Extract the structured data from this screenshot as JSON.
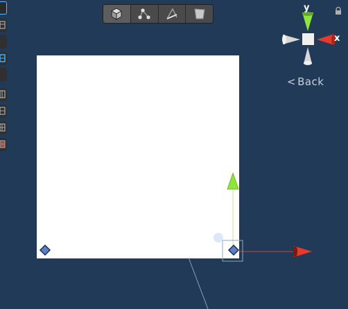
{
  "mode_toolbar": {
    "buttons": [
      {
        "icon": "object-mode-cube-icon",
        "active": true
      },
      {
        "icon": "vertex-mode-icon",
        "active": false
      },
      {
        "icon": "edge-mode-icon",
        "active": false
      },
      {
        "icon": "face-mode-icon",
        "active": false
      }
    ]
  },
  "orientation_gizmo": {
    "x_label": "x",
    "y_label": "y",
    "back_label": "Back",
    "back_arrow": "<"
  },
  "colors": {
    "background": "#213a58",
    "x_axis": "#e83a2a",
    "y_axis": "#8fe63a",
    "selection": "#8aa8c8"
  }
}
